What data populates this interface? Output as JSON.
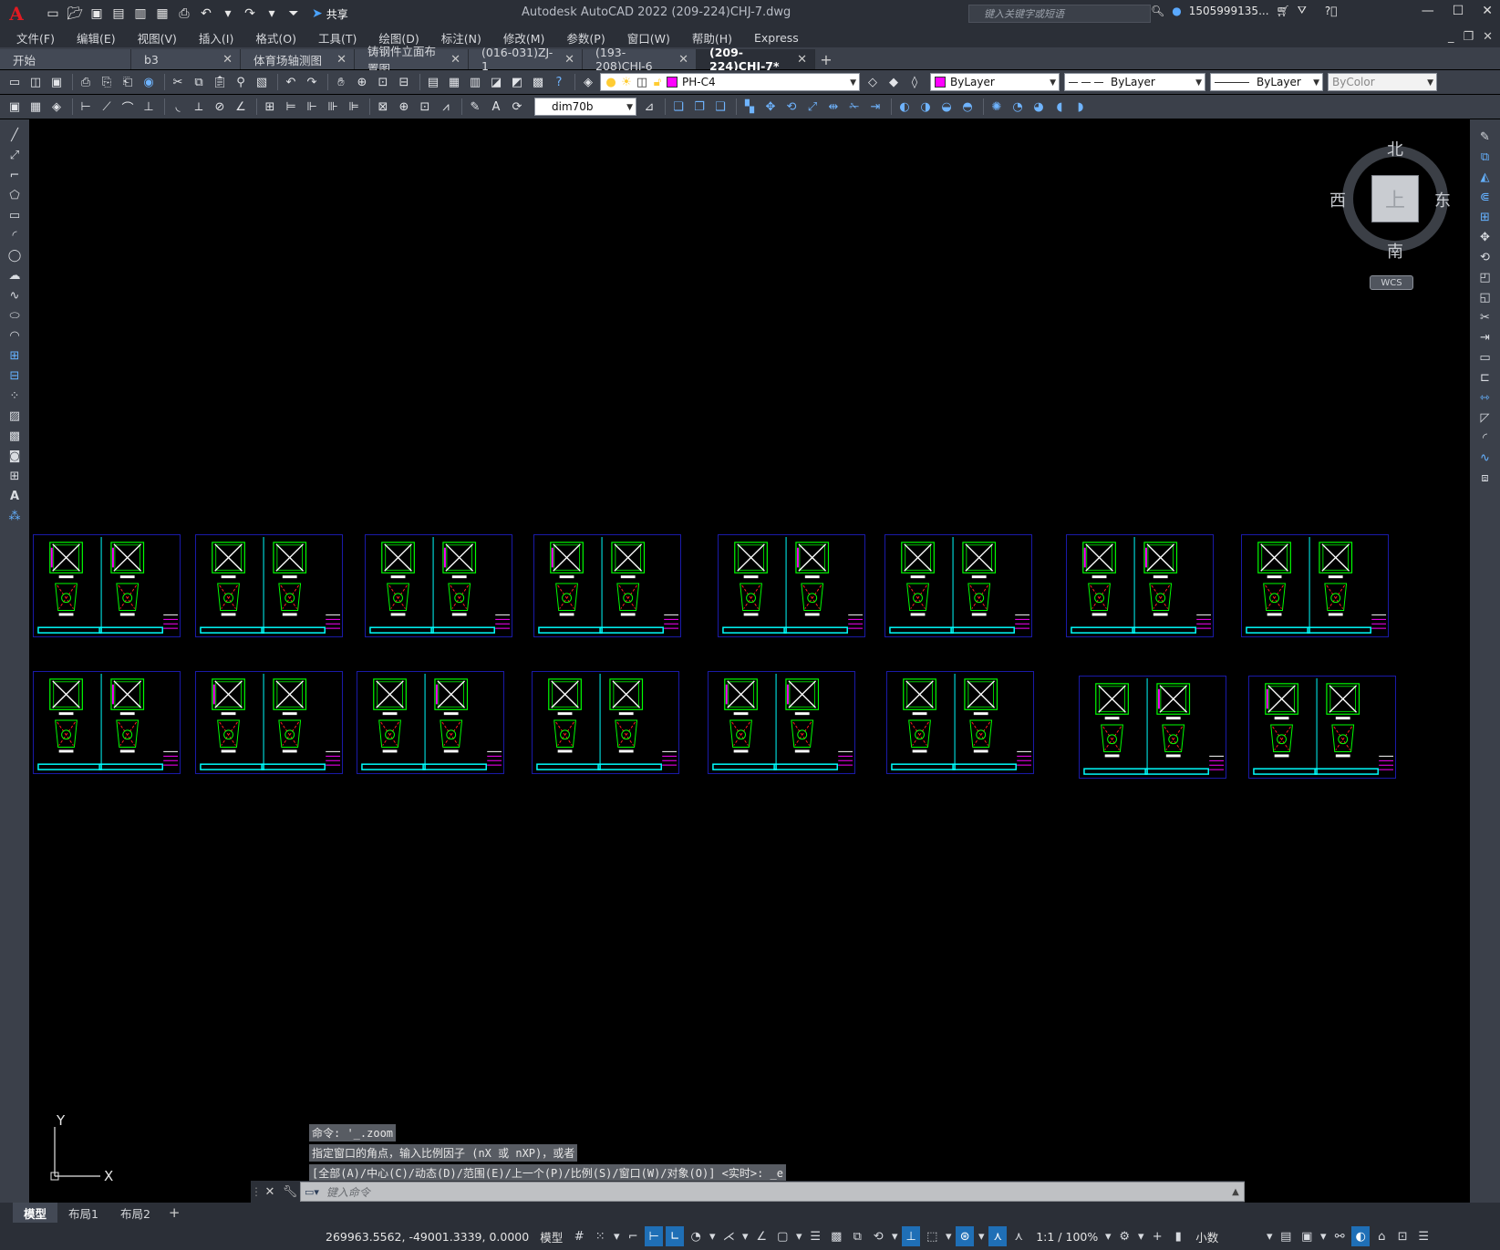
{
  "titlebar": {
    "app_logo": "A",
    "title": "Autodesk AutoCAD 2022    (209-224)CHJ-7.dwg",
    "share_label": "共享",
    "search_placeholder": "键入关键字或短语",
    "user_name": "1505999135..."
  },
  "menu": {
    "items": [
      "文件(F)",
      "编辑(E)",
      "视图(V)",
      "插入(I)",
      "格式(O)",
      "工具(T)",
      "绘图(D)",
      "标注(N)",
      "修改(M)",
      "参数(P)",
      "窗口(W)",
      "帮助(H)",
      "Express"
    ]
  },
  "tabs": [
    {
      "label": "开始",
      "closable": false
    },
    {
      "label": "b3",
      "closable": true
    },
    {
      "label": "体育场轴测图",
      "closable": true
    },
    {
      "label": "铸钢件立面布置图",
      "closable": true
    },
    {
      "label": "(016-031)ZJ-1",
      "closable": true
    },
    {
      "label": "(193-208)CHJ-6",
      "closable": true
    },
    {
      "label": "(209-224)CHJ-7*",
      "closable": true,
      "active": true
    }
  ],
  "toolbar": {
    "layer_name": "PH-C4",
    "color_value": "ByLayer",
    "linetype_value": "ByLayer",
    "lineweight_value": "ByLayer",
    "plotstyle_value": "ByColor",
    "dimstyle_value": "dim70b",
    "layer_color": "#ff00ff"
  },
  "viewcube": {
    "north": "北",
    "south": "南",
    "east": "东",
    "west": "西",
    "face": "上",
    "wcs": "WCS"
  },
  "ucs": {
    "x_label": "X",
    "y_label": "Y"
  },
  "command": {
    "history": [
      "命令: '_.zoom",
      "指定窗口的角点，输入比例因子 (nX 或 nXP)，或者",
      "[全部(A)/中心(C)/动态(D)/范围(E)/上一个(P)/比例(S)/窗口(W)/对象(O)] <实时>: _e"
    ],
    "placeholder": "键入命令"
  },
  "layout_tabs": [
    "模型",
    "布局1",
    "布局2"
  ],
  "status": {
    "coordinates": "269963.5562, -49001.3339, 0.0000",
    "model_label": "模型",
    "scale": "1:1 / 100%",
    "units": "小数"
  },
  "colors": {
    "accent": "#1f6fb6",
    "sheet_border": "#1a1aa8",
    "cyan": "#00ffff",
    "green": "#00ff00",
    "magenta": "#ff00ff",
    "red": "#ff2020"
  }
}
